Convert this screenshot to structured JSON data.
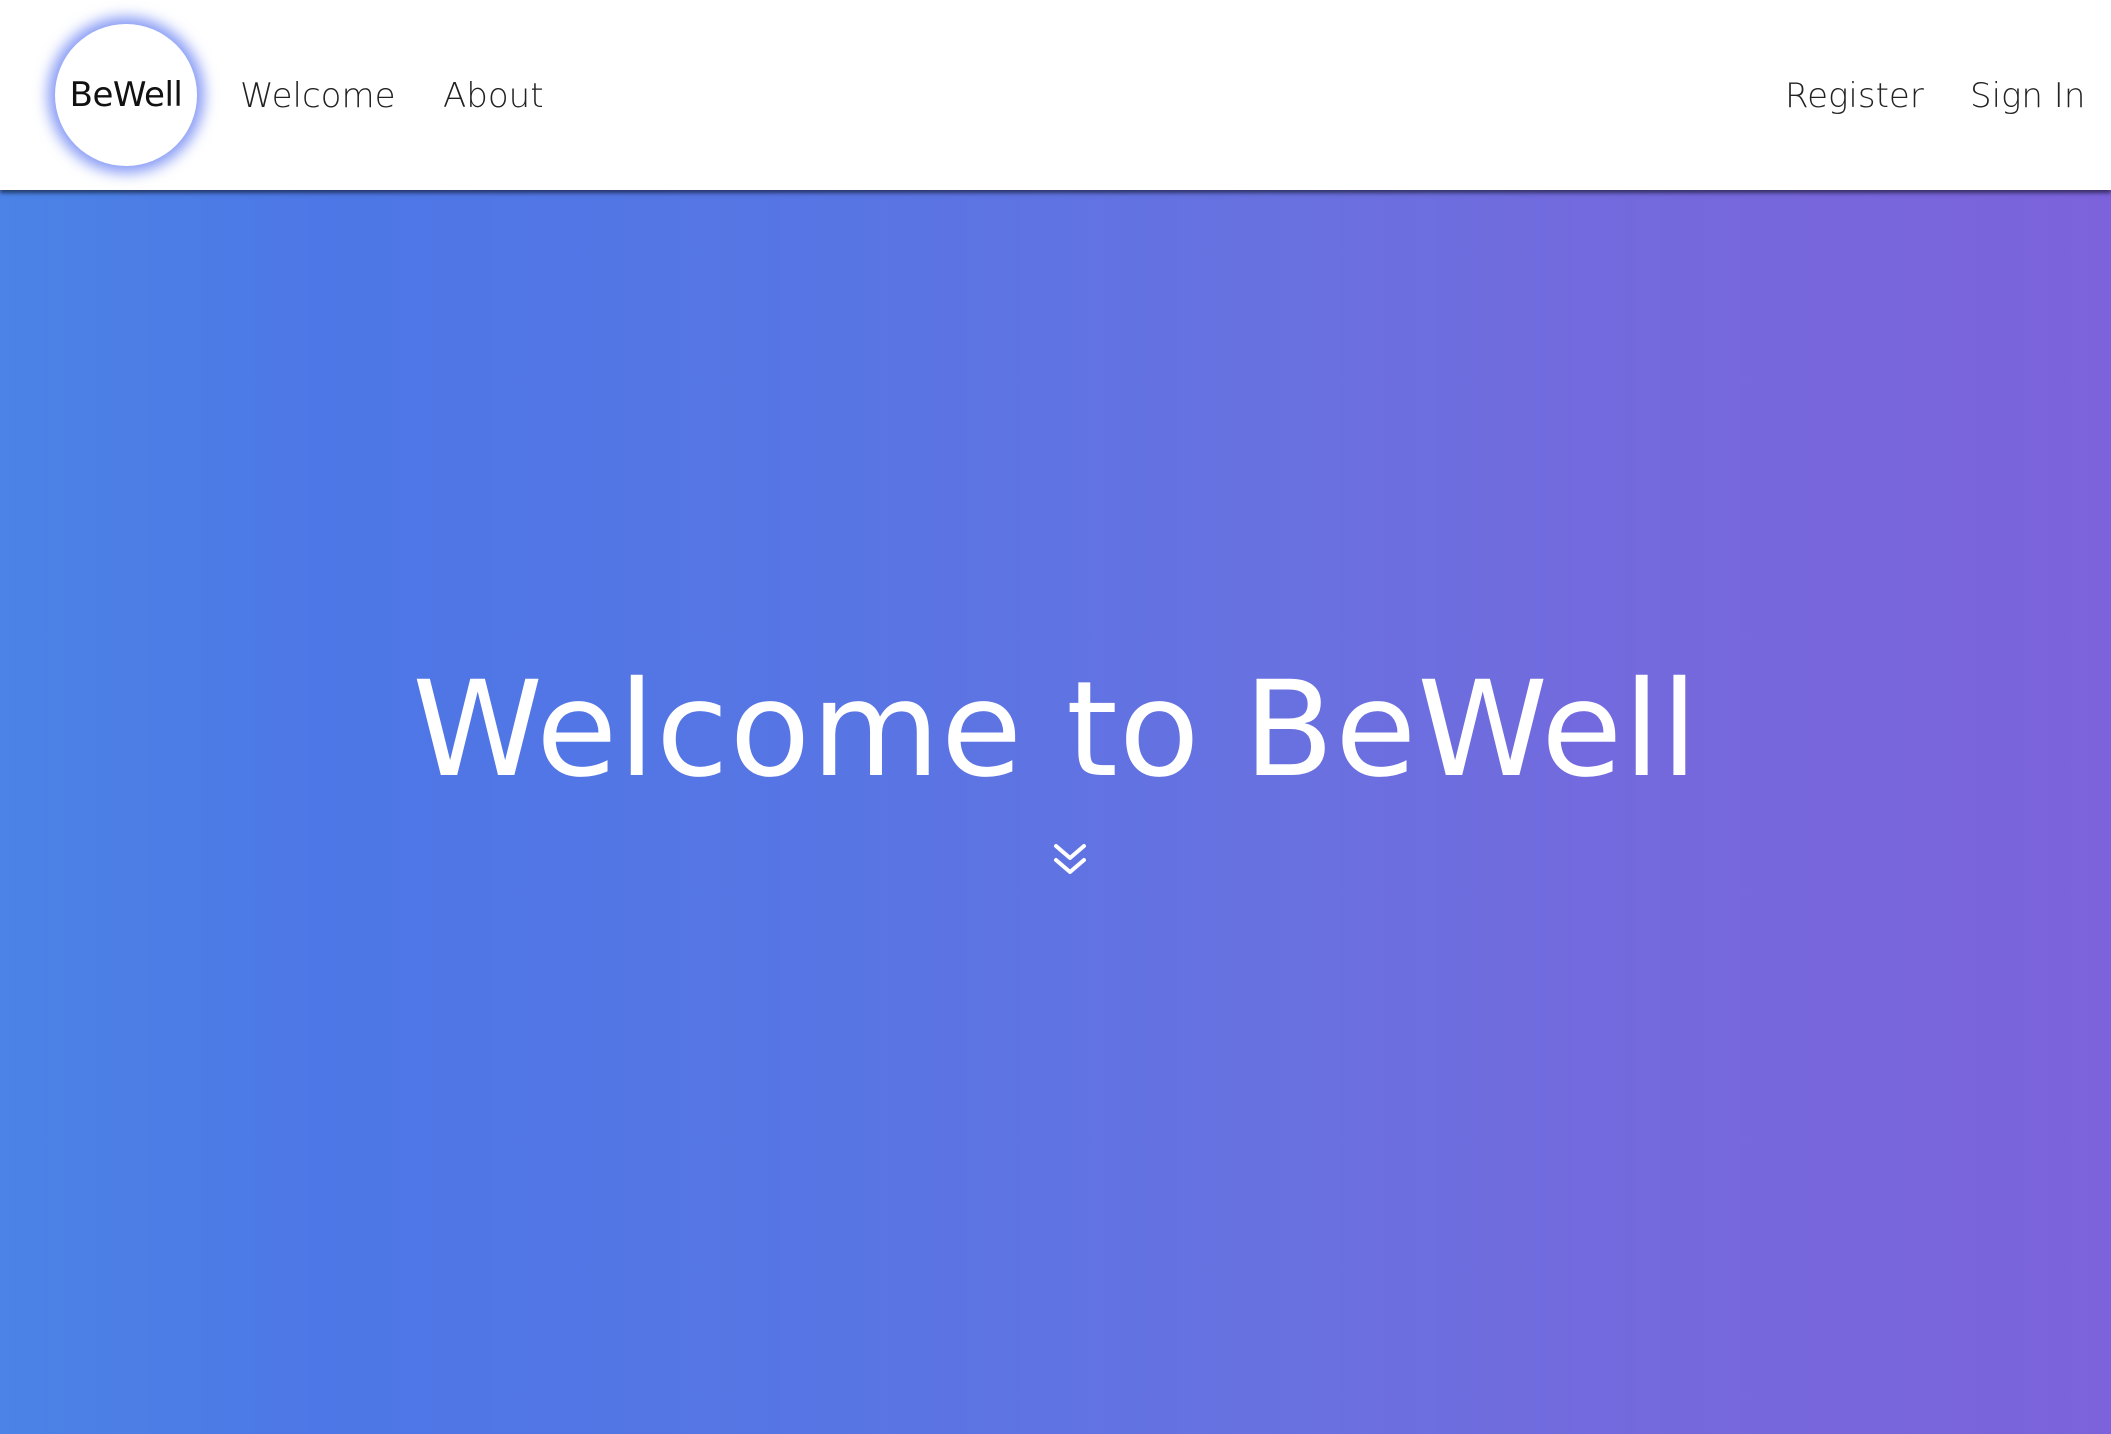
{
  "navbar": {
    "logo_text": "BeWell",
    "links_left": [
      "Welcome",
      "About"
    ],
    "links_right": [
      "Register",
      "Sign In"
    ]
  },
  "hero": {
    "title": "Welcome to BeWell",
    "scroll_icon": "double-chevron-down-icon",
    "gradient_start": "#4b83e6",
    "gradient_end": "#7c63db"
  }
}
